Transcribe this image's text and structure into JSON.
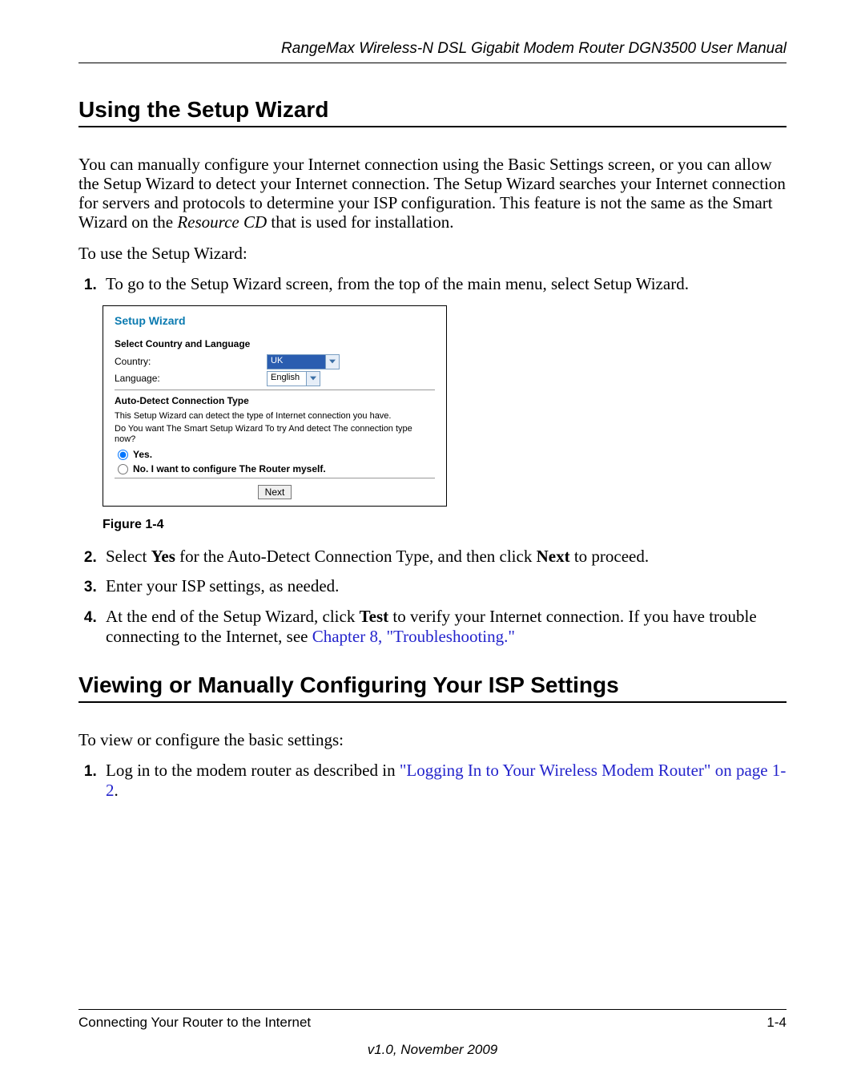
{
  "header": {
    "title": "RangeMax Wireless-N DSL Gigabit Modem Router DGN3500 User Manual"
  },
  "section1": {
    "heading": "Using the Setup Wizard",
    "para1_a": "You can manually configure your Internet connection using the Basic Settings screen, or you can allow the Setup Wizard to detect your Internet connection. The Setup Wizard searches your Internet connection for servers and protocols to determine your ISP configuration. This feature is not the same as the Smart Wizard on the ",
    "para1_italic": "Resource CD",
    "para1_b": " that is used for installation.",
    "para2": "To use the Setup Wizard:",
    "step1": "To go to the Setup Wizard screen, from the top of the main menu, select Setup Wizard.",
    "step2_a": "Select ",
    "step2_b": "Yes",
    "step2_c": " for the Auto-Detect Connection Type, and then click ",
    "step2_d": "Next",
    "step2_e": " to proceed.",
    "step3": "Enter your ISP settings, as needed.",
    "step4_a": "At the end of the Setup Wizard, click ",
    "step4_b": "Test",
    "step4_c": " to verify your Internet connection. If you have trouble connecting to the Internet, see ",
    "step4_link": "Chapter 8, \"Troubleshooting",
    "step4_d": ".\""
  },
  "figure": {
    "title": "Setup Wizard",
    "section_lang": "Select Country and Language",
    "country_label": "Country:",
    "country_value": "UK",
    "language_label": "Language:",
    "language_value": "English",
    "section_detect": "Auto-Detect Connection Type",
    "detect_line1": "This Setup Wizard can detect the type of Internet connection you have.",
    "detect_line2": "Do You want The Smart Setup Wizard To try And detect The connection type now?",
    "radio_yes": "Yes.",
    "radio_no": "No. I want to configure The Router myself.",
    "next_btn": "Next",
    "caption": "Figure 1-4"
  },
  "section2": {
    "heading": "Viewing or Manually Configuring Your ISP Settings",
    "para1": "To view or configure the basic settings:",
    "step1_a": "Log in to the modem router as described in ",
    "step1_link": "\"Logging In to Your Wireless Modem Router\" on page 1-2",
    "step1_b": "."
  },
  "footer": {
    "left": "Connecting Your Router to the Internet",
    "right": "1-4",
    "version": "v1.0, November 2009"
  }
}
